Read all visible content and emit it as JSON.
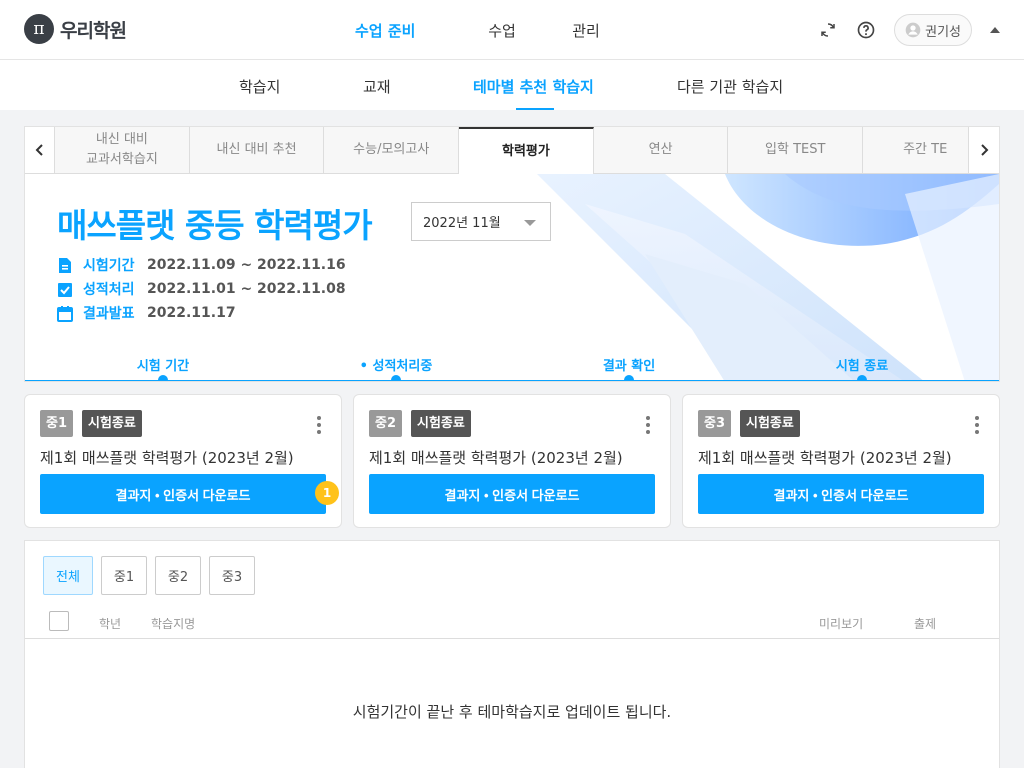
{
  "brand": {
    "logo_glyph": "π",
    "name": "우리학원"
  },
  "main_nav": [
    "수업 준비",
    "수업",
    "관리"
  ],
  "user": {
    "name": "권기성"
  },
  "sub_nav": [
    "학습지",
    "교재",
    "테마별 추천 학습지",
    "다른 기관 학습지"
  ],
  "tabs": [
    "내신 대비\n교과서학습지",
    "내신 대비 추천",
    "수능/모의고사",
    "학력평가",
    "연산",
    "입학 TEST",
    "주간 TE"
  ],
  "hero": {
    "title": "매쓰플랫 중등 학력평가",
    "month": "2022년 11월",
    "rows": [
      {
        "label": "시험기간",
        "value": "2022.11.09 ~ 2022.11.16"
      },
      {
        "label": "성적처리",
        "value": "2022.11.01 ~ 2022.11.08"
      },
      {
        "label": "결과발표",
        "value": "2022.11.17"
      }
    ],
    "steps": [
      "시험 기간",
      "• 성적처리중",
      "결과 확인",
      "시험 종료"
    ]
  },
  "cards": [
    {
      "grade": "중1",
      "status": "시험종료",
      "title": "제1회 매쓰플랫 학력평가 (2023년 2월)",
      "button": "결과지 • 인증서 다운로드",
      "badge": "1"
    },
    {
      "grade": "중2",
      "status": "시험종료",
      "title": "제1회 매쓰플랫 학력평가 (2023년 2월)",
      "button": "결과지 • 인증서 다운로드"
    },
    {
      "grade": "중3",
      "status": "시험종료",
      "title": "제1회 매쓰플랫 학력평가 (2023년 2월)",
      "button": "결과지 • 인증서 다운로드"
    }
  ],
  "filters": [
    "전체",
    "중1",
    "중2",
    "중3"
  ],
  "table_headers": {
    "grade": "학년",
    "name": "학습지명",
    "preview": "미리보기",
    "publish": "출제"
  },
  "empty_message": "시험기간이 끝난 후 테마학습지로 업데이트 됩니다.",
  "colors": {
    "accent": "#0aa3ff",
    "badge_grade": "#999999",
    "badge_status": "#555555",
    "notification": "#ffc21a"
  }
}
